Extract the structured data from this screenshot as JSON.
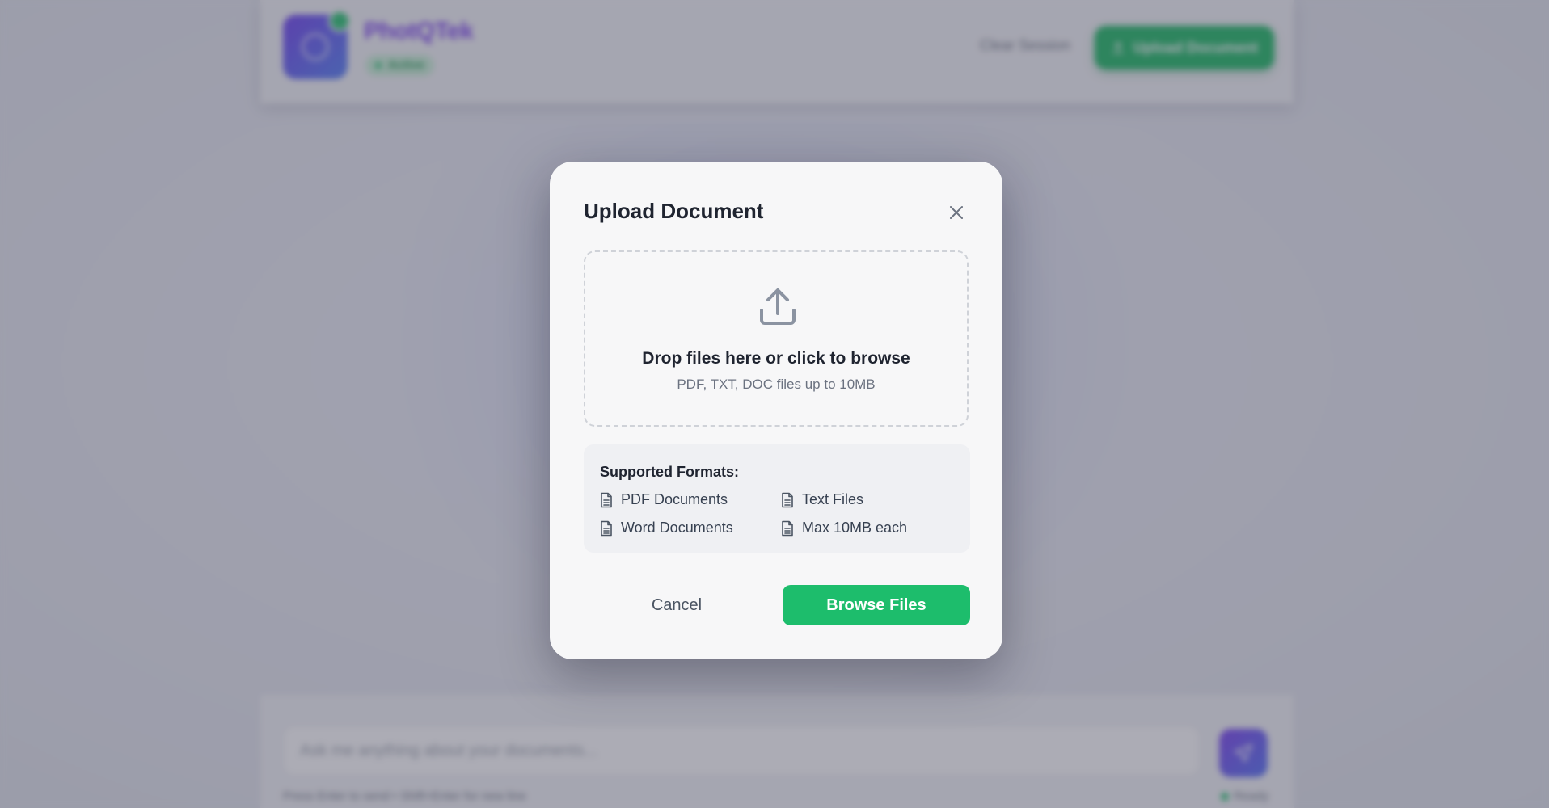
{
  "background": {
    "header": {
      "brand_name": "PhotQTek",
      "status_label": "Active",
      "clear_session_label": "Clear Session",
      "upload_button_label": "Upload Document"
    },
    "chat": {
      "input_placeholder": "Ask me anything about your documents...",
      "hint": "Press Enter to send • Shift+Enter for new line",
      "status": "Ready"
    }
  },
  "modal": {
    "title": "Upload Document",
    "close_icon": "close-icon",
    "dropzone": {
      "icon": "upload-icon",
      "title": "Drop files here or click to browse",
      "subtitle": "PDF, TXT, DOC files up to 10MB"
    },
    "formats": {
      "title": "Supported Formats:",
      "items": [
        {
          "label": "PDF Documents",
          "icon": "document-icon"
        },
        {
          "label": "Text Files",
          "icon": "document-icon"
        },
        {
          "label": "Word Documents",
          "icon": "document-icon"
        },
        {
          "label": "Max 10MB each",
          "icon": "document-icon"
        }
      ]
    },
    "cancel_label": "Cancel",
    "browse_label": "Browse Files"
  },
  "colors": {
    "accent_green": "#1dbd6c",
    "brand_purple": "#7a3ff0",
    "text_dark": "#1f2430",
    "text_muted": "#6b7280"
  }
}
